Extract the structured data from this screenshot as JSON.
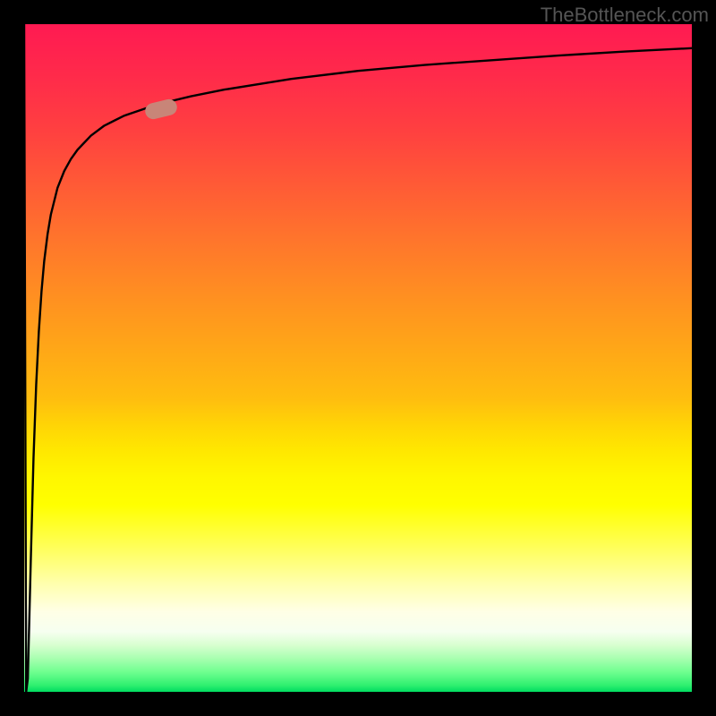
{
  "credit": "TheBottleneck.com",
  "colors": {
    "frame": "#000000",
    "marker": "#c88578",
    "curve": "#000000"
  },
  "chart_data": {
    "type": "line",
    "title": "",
    "xlabel": "",
    "ylabel": "",
    "x_range": [
      0,
      100
    ],
    "y_range": [
      0,
      100
    ],
    "grid": false,
    "legend": false,
    "annotations": [
      {
        "type": "marker",
        "x": 20.5,
        "y": 87.2,
        "shape": "pill",
        "color": "#c88578"
      }
    ],
    "series": [
      {
        "name": "curve",
        "x": [
          0.0,
          0.3,
          0.55,
          1.0,
          1.4,
          1.8,
          2.2,
          2.6,
          3.0,
          3.5,
          4.0,
          5.0,
          6.0,
          7.0,
          8.0,
          10.0,
          12.0,
          15.0,
          20.0,
          25.0,
          30.0,
          40.0,
          50.0,
          60.0,
          70.0,
          80.0,
          90.0,
          100.0
        ],
        "y": [
          100.0,
          0.0,
          2.0,
          20.0,
          35.0,
          46.0,
          54.0,
          60.0,
          64.5,
          68.5,
          71.5,
          75.5,
          78.0,
          79.8,
          81.2,
          83.3,
          84.8,
          86.3,
          88.0,
          89.2,
          90.2,
          91.8,
          93.0,
          93.9,
          94.6,
          95.3,
          95.9,
          96.4
        ]
      }
    ],
    "background_gradient": {
      "direction": "vertical",
      "stops": [
        {
          "pos": 0.0,
          "color": "#ff1a52"
        },
        {
          "pos": 0.5,
          "color": "#ffa518"
        },
        {
          "pos": 0.72,
          "color": "#ffff00"
        },
        {
          "pos": 0.88,
          "color": "#ffffe6"
        },
        {
          "pos": 1.0,
          "color": "#00dc60"
        }
      ]
    }
  }
}
